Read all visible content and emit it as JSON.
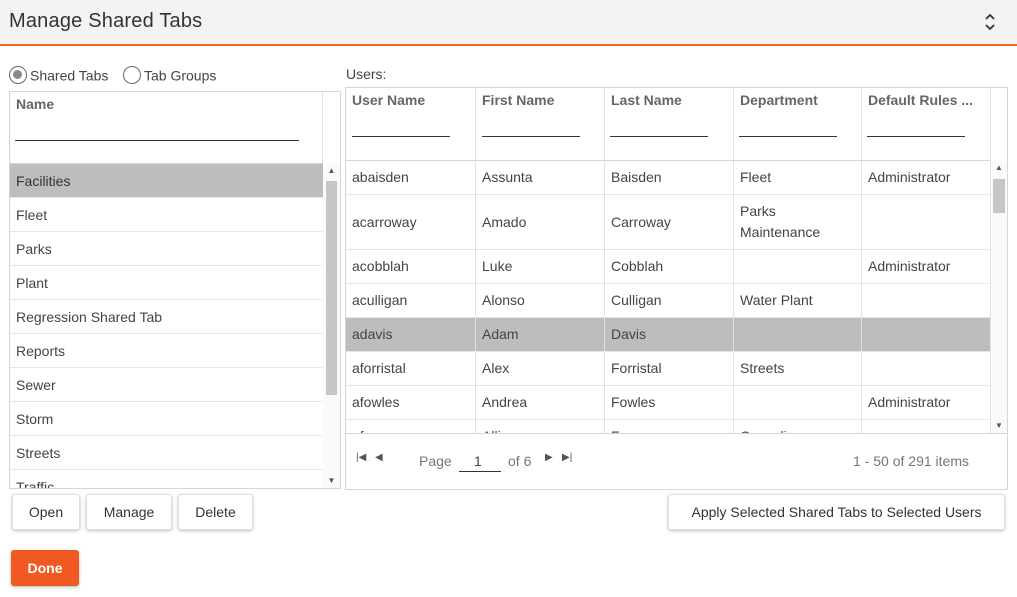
{
  "header": {
    "title": "Manage Shared Tabs"
  },
  "view_toggle": {
    "options": [
      {
        "label": "Shared Tabs",
        "checked": true
      },
      {
        "label": "Tab Groups",
        "checked": false
      }
    ]
  },
  "tabs_grid": {
    "column": "Name",
    "rows": [
      "Facilities",
      "Fleet",
      "Parks",
      "Plant",
      "Regression Shared Tab",
      "Reports",
      "Sewer",
      "Storm",
      "Streets",
      "Traffic"
    ],
    "selected": "Facilities"
  },
  "users_grid": {
    "label": "Users:",
    "columns": [
      "User Name",
      "First Name",
      "Last Name",
      "Department",
      "Default Rules ..."
    ],
    "rows": [
      [
        "abaisden",
        "Assunta",
        "Baisden",
        "Fleet",
        "Administrator"
      ],
      [
        "acarroway",
        "Amado",
        "Carroway",
        "Parks Maintenance",
        ""
      ],
      [
        "acobblah",
        "Luke",
        "Cobblah",
        "",
        "Administrator"
      ],
      [
        "aculligan",
        "Alonso",
        "Culligan",
        "Water Plant",
        ""
      ],
      [
        "adavis",
        "Adam",
        "Davis",
        "",
        ""
      ],
      [
        "aforristal",
        "Alex",
        "Forristal",
        "Streets",
        ""
      ],
      [
        "afowles",
        "Andrea",
        "Fowles",
        "",
        "Administrator"
      ],
      [
        "afr",
        "Allis",
        "Fr",
        "Conveli",
        ""
      ]
    ],
    "selected_row": "adavis",
    "pager": {
      "page_label": "Page",
      "page_value": "1",
      "of_label": "of 6",
      "items_label": "1 - 50 of 291 items"
    }
  },
  "buttons": {
    "open": "Open",
    "manage": "Manage",
    "delete": "Delete",
    "apply": "Apply Selected Shared Tabs to Selected Users",
    "done": "Done"
  },
  "colors": {
    "accent": "#f05a22",
    "selected_row": "#bdbdbd",
    "header_bg": "#f3f3f3"
  }
}
